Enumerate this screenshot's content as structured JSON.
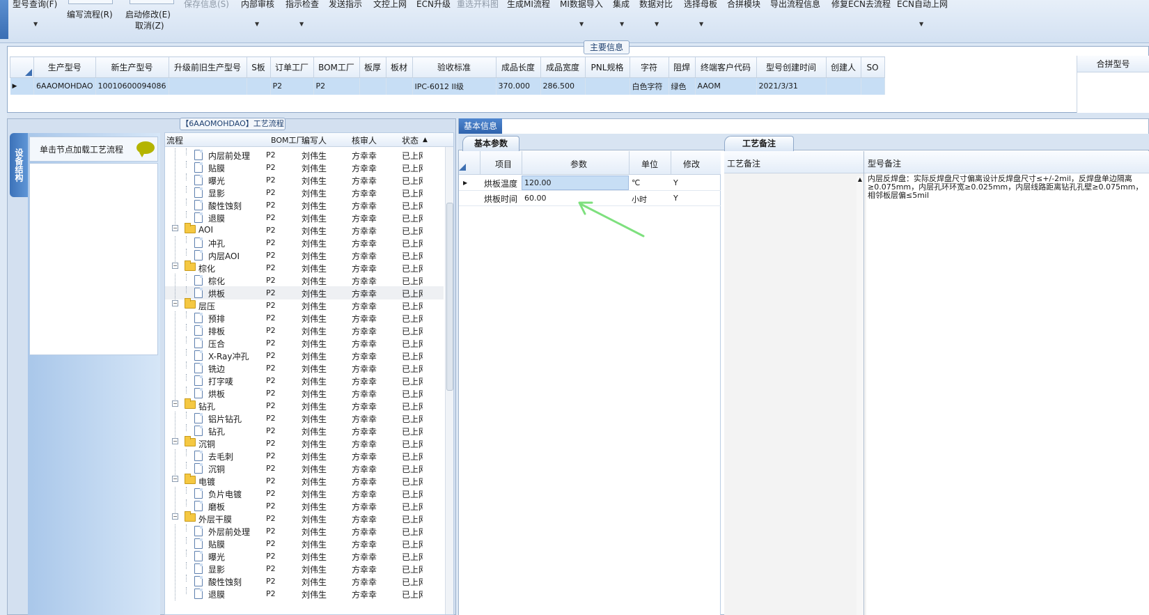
{
  "toolbar": {
    "row1": [
      "型号查询(F)",
      "保存信息(S)",
      "内部审核",
      "指示检查",
      "发送指示",
      "文控上网",
      "ECN升级",
      "重选开料图",
      "生成MI流程",
      "MI数据导入",
      "集成",
      "数据对比",
      "选择母板",
      "合拼模块",
      "导出流程信息",
      "修复ECN去流程",
      "ECN自动上网"
    ],
    "row2": [
      "编写流程(R)",
      "启动修改(E)"
    ],
    "row3": [
      "取消(Z)"
    ]
  },
  "main_info": {
    "title": "主要信息",
    "columns": [
      "生产型号",
      "新生产型号",
      "升级前旧生产型号",
      "S板",
      "订单工厂",
      "BOM工厂",
      "板厚",
      "板材",
      "验收标准",
      "成品长度",
      "成品宽度",
      "PNL规格",
      "字符",
      "阻焊",
      "终端客户代码",
      "型号创建时间",
      "创建人",
      "SO"
    ],
    "row": [
      "6AAOMOHDAO",
      "10010600094086",
      "",
      "",
      "P2",
      "P2",
      "",
      "",
      "IPC-6012 II级",
      "370.000",
      "286.500",
      "",
      "白色字符",
      "绿色",
      "AAOM",
      "2021/3/31",
      "",
      ""
    ],
    "merge_label": "合拼型号"
  },
  "process_panel": {
    "title": "【6AAOMOHDAO】工艺流程",
    "side_tab": "设备结构",
    "load_hint": "单击节点加载工艺流程",
    "columns": [
      "流程",
      "BOM工厂",
      "编写人",
      "核审人",
      "状态"
    ],
    "rows": [
      {
        "name": "内层前处理",
        "type": "doc",
        "lvl": 2,
        "factory": "P2",
        "writer": "刘伟生",
        "reviewer": "方幸幸",
        "status": "已上网"
      },
      {
        "name": "贴膜",
        "type": "doc",
        "lvl": 2,
        "factory": "P2",
        "writer": "刘伟生",
        "reviewer": "方幸幸",
        "status": "已上网"
      },
      {
        "name": "曝光",
        "type": "doc",
        "lvl": 2,
        "factory": "P2",
        "writer": "刘伟生",
        "reviewer": "方幸幸",
        "status": "已上网"
      },
      {
        "name": "显影",
        "type": "doc",
        "lvl": 2,
        "factory": "P2",
        "writer": "刘伟生",
        "reviewer": "方幸幸",
        "status": "已上网"
      },
      {
        "name": "酸性蚀刻",
        "type": "doc",
        "lvl": 2,
        "factory": "P2",
        "writer": "刘伟生",
        "reviewer": "方幸幸",
        "status": "已上网"
      },
      {
        "name": "退膜",
        "type": "doc",
        "lvl": 2,
        "factory": "P2",
        "writer": "刘伟生",
        "reviewer": "方幸幸",
        "status": "已上网"
      },
      {
        "name": "AOI",
        "type": "folder",
        "lvl": 1,
        "factory": "P2",
        "writer": "刘伟生",
        "reviewer": "方幸幸",
        "status": "已上网"
      },
      {
        "name": "冲孔",
        "type": "doc",
        "lvl": 2,
        "factory": "P2",
        "writer": "刘伟生",
        "reviewer": "方幸幸",
        "status": "已上网"
      },
      {
        "name": "内层AOI",
        "type": "doc",
        "lvl": 2,
        "factory": "P2",
        "writer": "刘伟生",
        "reviewer": "方幸幸",
        "status": "已上网"
      },
      {
        "name": "棕化",
        "type": "folder",
        "lvl": 1,
        "factory": "P2",
        "writer": "刘伟生",
        "reviewer": "方幸幸",
        "status": "已上网"
      },
      {
        "name": "棕化",
        "type": "doc",
        "lvl": 2,
        "factory": "P2",
        "writer": "刘伟生",
        "reviewer": "方幸幸",
        "status": "已上网"
      },
      {
        "name": "烘板",
        "type": "doc",
        "lvl": 2,
        "factory": "P2",
        "writer": "刘伟生",
        "reviewer": "方幸幸",
        "status": "已上网",
        "selected": true
      },
      {
        "name": "层压",
        "type": "folder",
        "lvl": 1,
        "factory": "P2",
        "writer": "刘伟生",
        "reviewer": "方幸幸",
        "status": "已上网"
      },
      {
        "name": "预排",
        "type": "doc",
        "lvl": 2,
        "factory": "P2",
        "writer": "刘伟生",
        "reviewer": "方幸幸",
        "status": "已上网"
      },
      {
        "name": "排板",
        "type": "doc",
        "lvl": 2,
        "factory": "P2",
        "writer": "刘伟生",
        "reviewer": "方幸幸",
        "status": "已上网"
      },
      {
        "name": "压合",
        "type": "doc",
        "lvl": 2,
        "factory": "P2",
        "writer": "刘伟生",
        "reviewer": "方幸幸",
        "status": "已上网"
      },
      {
        "name": "X-Ray冲孔",
        "type": "doc",
        "lvl": 2,
        "factory": "P2",
        "writer": "刘伟生",
        "reviewer": "方幸幸",
        "status": "已上网"
      },
      {
        "name": "铣边",
        "type": "doc",
        "lvl": 2,
        "factory": "P2",
        "writer": "刘伟生",
        "reviewer": "方幸幸",
        "status": "已上网"
      },
      {
        "name": "打字唛",
        "type": "doc",
        "lvl": 2,
        "factory": "P2",
        "writer": "刘伟生",
        "reviewer": "方幸幸",
        "status": "已上网"
      },
      {
        "name": "烘板",
        "type": "doc",
        "lvl": 2,
        "factory": "P2",
        "writer": "刘伟生",
        "reviewer": "方幸幸",
        "status": "已上网"
      },
      {
        "name": "钻孔",
        "type": "folder",
        "lvl": 1,
        "factory": "P2",
        "writer": "刘伟生",
        "reviewer": "方幸幸",
        "status": "已上网"
      },
      {
        "name": "铝片钻孔",
        "type": "doc",
        "lvl": 2,
        "factory": "P2",
        "writer": "刘伟生",
        "reviewer": "方幸幸",
        "status": "已上网"
      },
      {
        "name": "钻孔",
        "type": "doc",
        "lvl": 2,
        "factory": "P2",
        "writer": "刘伟生",
        "reviewer": "方幸幸",
        "status": "已上网"
      },
      {
        "name": "沉铜",
        "type": "folder",
        "lvl": 1,
        "factory": "P2",
        "writer": "刘伟生",
        "reviewer": "方幸幸",
        "status": "已上网"
      },
      {
        "name": "去毛刺",
        "type": "doc",
        "lvl": 2,
        "factory": "P2",
        "writer": "刘伟生",
        "reviewer": "方幸幸",
        "status": "已上网"
      },
      {
        "name": "沉铜",
        "type": "doc",
        "lvl": 2,
        "factory": "P2",
        "writer": "刘伟生",
        "reviewer": "方幸幸",
        "status": "已上网"
      },
      {
        "name": "电镀",
        "type": "folder",
        "lvl": 1,
        "factory": "P2",
        "writer": "刘伟生",
        "reviewer": "方幸幸",
        "status": "已上网"
      },
      {
        "name": "负片电镀",
        "type": "doc",
        "lvl": 2,
        "factory": "P2",
        "writer": "刘伟生",
        "reviewer": "方幸幸",
        "status": "已上网"
      },
      {
        "name": "磨板",
        "type": "doc",
        "lvl": 2,
        "factory": "P2",
        "writer": "刘伟生",
        "reviewer": "方幸幸",
        "status": "已上网"
      },
      {
        "name": "外层干膜",
        "type": "folder",
        "lvl": 1,
        "factory": "P2",
        "writer": "刘伟生",
        "reviewer": "方幸幸",
        "status": "已上网"
      },
      {
        "name": "外层前处理",
        "type": "doc",
        "lvl": 2,
        "factory": "P2",
        "writer": "刘伟生",
        "reviewer": "方幸幸",
        "status": "已上网"
      },
      {
        "name": "贴膜",
        "type": "doc",
        "lvl": 2,
        "factory": "P2",
        "writer": "刘伟生",
        "reviewer": "方幸幸",
        "status": "已上网"
      },
      {
        "name": "曝光",
        "type": "doc",
        "lvl": 2,
        "factory": "P2",
        "writer": "刘伟生",
        "reviewer": "方幸幸",
        "status": "已上网"
      },
      {
        "name": "显影",
        "type": "doc",
        "lvl": 2,
        "factory": "P2",
        "writer": "刘伟生",
        "reviewer": "方幸幸",
        "status": "已上网"
      },
      {
        "name": "酸性蚀刻",
        "type": "doc",
        "lvl": 2,
        "factory": "P2",
        "writer": "刘伟生",
        "reviewer": "方幸幸",
        "status": "已上网"
      },
      {
        "name": "退膜",
        "type": "doc",
        "lvl": 2,
        "factory": "P2",
        "writer": "刘伟生",
        "reviewer": "方幸幸",
        "status": "已上网"
      }
    ]
  },
  "basic_info": {
    "tab": "基本信息",
    "params_tab": "基本参数",
    "remarks_tab": "工艺备注",
    "param_columns": [
      "项目",
      "参数",
      "单位",
      "修改"
    ],
    "params": [
      {
        "item": "烘板温度",
        "value": "120.00",
        "unit": "℃",
        "modified": "Y"
      },
      {
        "item": "烘板时间",
        "value": "60.00",
        "unit": "小时",
        "modified": "Y"
      }
    ],
    "remark_columns": [
      "工艺备注",
      "型号备注"
    ],
    "model_remark": "内层反焊盘：实际反焊盘尺寸偏离设计反焊盘尺寸≤+/-2mil，反焊盘单边隔离≥0.075mm，内层孔环环宽≥0.025mm，内层线路距离钻孔孔壁≥0.075mm，相邻板层偏≤5mil"
  },
  "colors": {
    "accent": "#2f63ad",
    "selection": "#c7def5",
    "arrow": "#7ee07e"
  }
}
